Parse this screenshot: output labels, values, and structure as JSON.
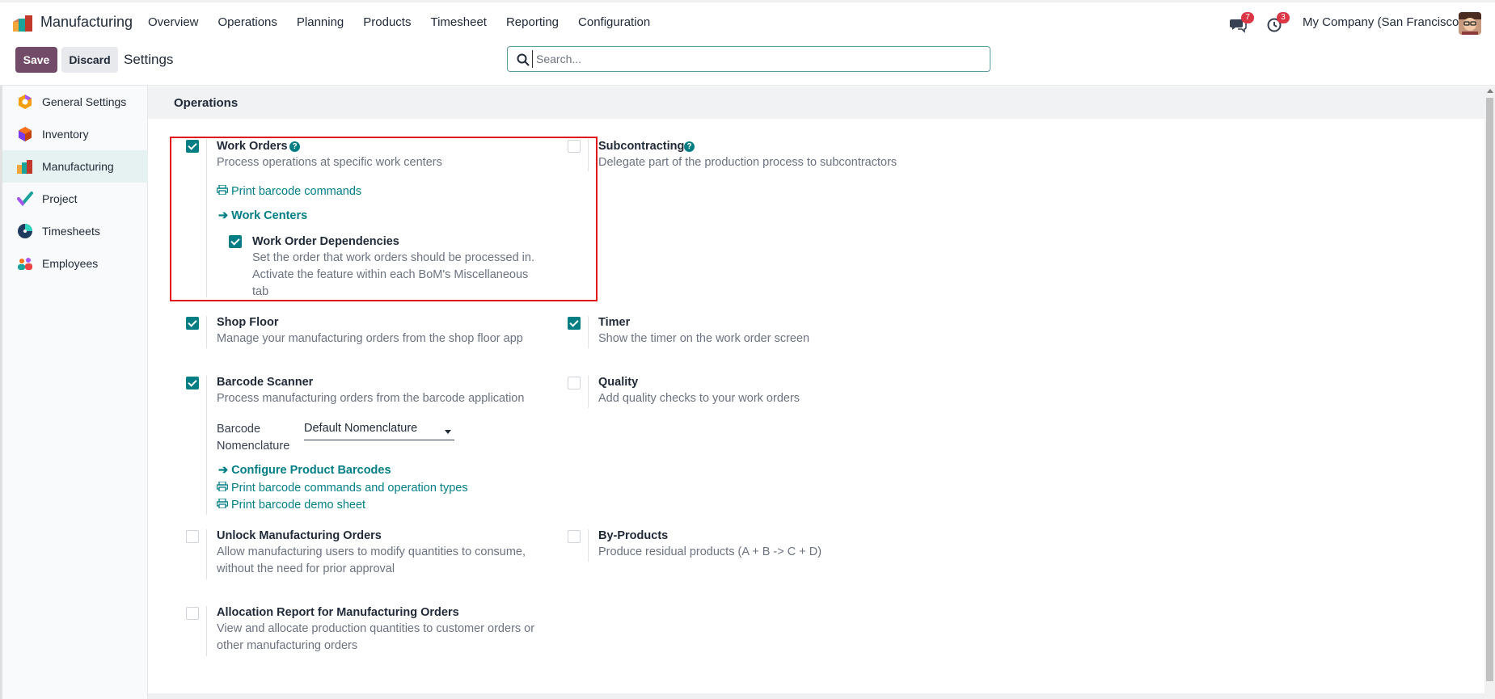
{
  "app": {
    "name": "Manufacturing"
  },
  "menu": [
    "Overview",
    "Operations",
    "Planning",
    "Products",
    "Timesheet",
    "Reporting",
    "Configuration"
  ],
  "systray": {
    "messages_badge": "7",
    "activities_badge": "3",
    "company": "My Company (San Francisco)"
  },
  "control_panel": {
    "save_label": "Save",
    "discard_label": "Discard",
    "title": "Settings",
    "search_placeholder": "Search..."
  },
  "sidebar": {
    "items": [
      {
        "label": "General Settings",
        "icon": "odoo-hexagon-icon"
      },
      {
        "label": "Inventory",
        "icon": "inventory-box-icon"
      },
      {
        "label": "Manufacturing",
        "icon": "manufacturing-factory-icon",
        "active": true
      },
      {
        "label": "Project",
        "icon": "project-check-icon"
      },
      {
        "label": "Timesheets",
        "icon": "timesheet-clock-icon"
      },
      {
        "label": "Employees",
        "icon": "employees-people-icon"
      }
    ]
  },
  "section": {
    "title": "Operations"
  },
  "settings": {
    "work_orders": {
      "title": "Work Orders",
      "desc": "Process operations at specific work centers",
      "checked": true,
      "link_print": "Print barcode commands",
      "link_centers": "Work Centers",
      "dep_title": "Work Order Dependencies",
      "dep_desc1": "Set the order that work orders should be processed in.",
      "dep_desc2": "Activate the feature within each BoM's Miscellaneous",
      "dep_desc3": "tab",
      "dep_checked": true
    },
    "subcontracting": {
      "title": "Subcontracting",
      "desc": "Delegate part of the production process to subcontractors",
      "checked": false
    },
    "shop_floor": {
      "title": "Shop Floor",
      "desc": "Manage your manufacturing orders from the shop floor app",
      "checked": true
    },
    "timer": {
      "title": "Timer",
      "desc": "Show the timer on the work order screen",
      "checked": true
    },
    "barcode": {
      "title": "Barcode Scanner",
      "desc": "Process manufacturing orders from the barcode application",
      "checked": true,
      "nomenclature_label_1": "Barcode",
      "nomenclature_label_2": "Nomenclature",
      "nomenclature_value": "Default Nomenclature",
      "link_configure": "Configure Product Barcodes",
      "link_print_types": "Print barcode commands and operation types",
      "link_demo": "Print barcode demo sheet"
    },
    "quality": {
      "title": "Quality",
      "desc": "Add quality checks to your work orders",
      "checked": false
    },
    "unlock": {
      "title": "Unlock Manufacturing Orders",
      "desc1": "Allow manufacturing users to modify quantities to consume,",
      "desc2": "without the need for prior approval",
      "checked": false
    },
    "byproducts": {
      "title": "By-Products",
      "desc": "Produce residual products (A + B -> C + D)",
      "checked": false
    },
    "allocation": {
      "title": "Allocation Report for Manufacturing Orders",
      "desc1": "View and allocate production quantities to customer orders or",
      "desc2": "other manufacturing orders",
      "checked": false
    }
  },
  "colors": {
    "brand": "#714b67",
    "accent": "#017e84",
    "highlight": "#e3161b"
  }
}
